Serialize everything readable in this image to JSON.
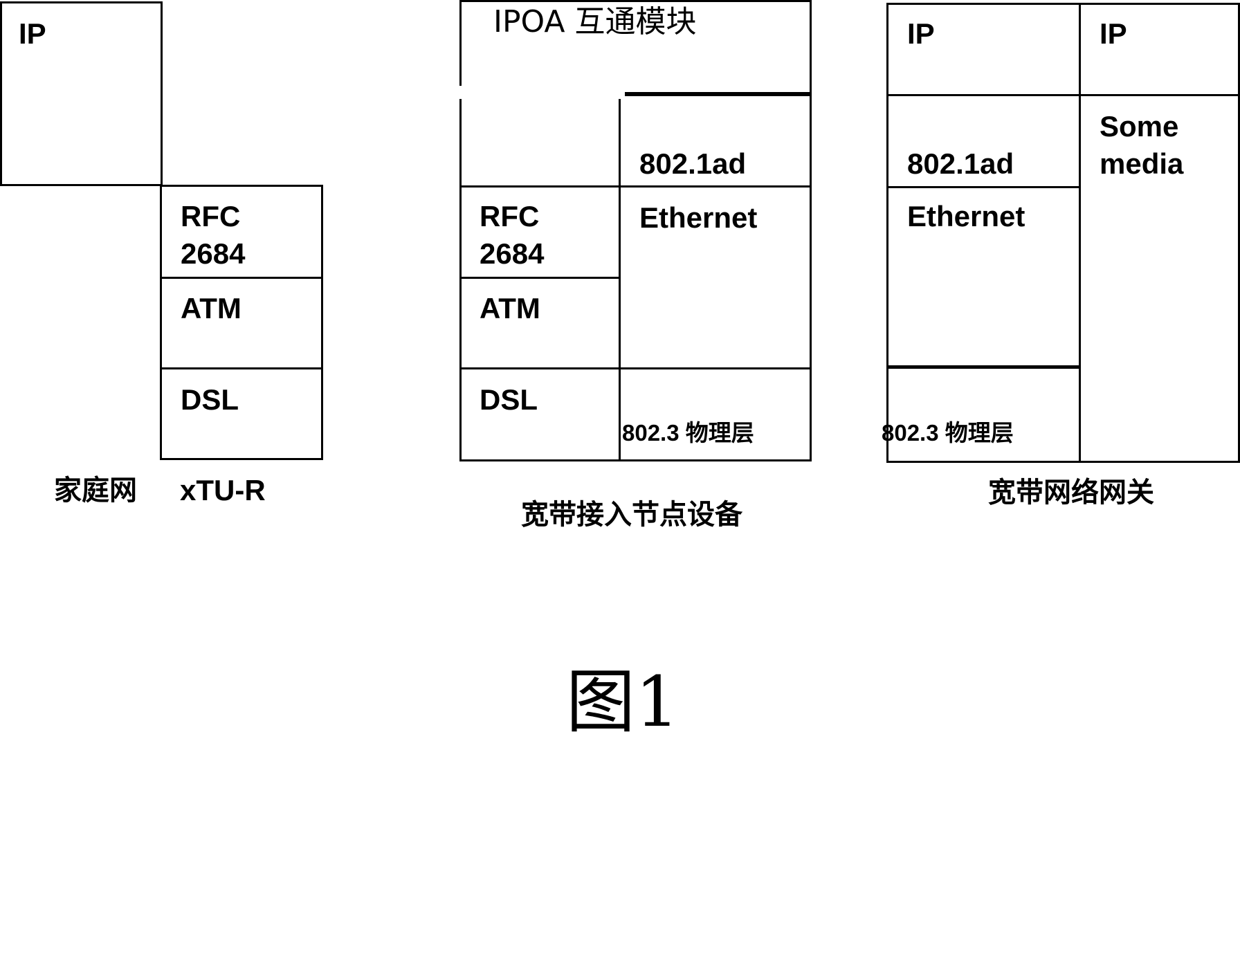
{
  "figure": {
    "caption": "图1",
    "groups": [
      {
        "id": "home-network",
        "label": "家庭网",
        "stack": [
          {
            "label": "IP"
          }
        ]
      },
      {
        "id": "xtu-r",
        "label": "xTU-R",
        "stack": [
          {
            "label": "RFC\n2684"
          },
          {
            "label": "ATM"
          },
          {
            "label": "DSL"
          }
        ]
      },
      {
        "id": "broadband-access-node",
        "label": "宽带接入节点设备",
        "module_label": "IPOA 互通模块",
        "left_stack": [
          {
            "label": "RFC\n2684"
          },
          {
            "label": "ATM"
          },
          {
            "label": "DSL"
          }
        ],
        "right_stack": [
          {
            "label": "802.1ad"
          },
          {
            "label": "Ethernet"
          },
          {
            "label": "802.3 物理层"
          }
        ]
      },
      {
        "id": "broadband-network-gateway",
        "label": "宽带网络网关",
        "left_stack": [
          {
            "label": "IP"
          },
          {
            "label": "802.1ad"
          },
          {
            "label": "Ethernet"
          },
          {
            "label": "802.3 物理层"
          }
        ],
        "right_stack": [
          {
            "label": "IP"
          },
          {
            "label": "Some\nmedia"
          }
        ]
      }
    ]
  }
}
